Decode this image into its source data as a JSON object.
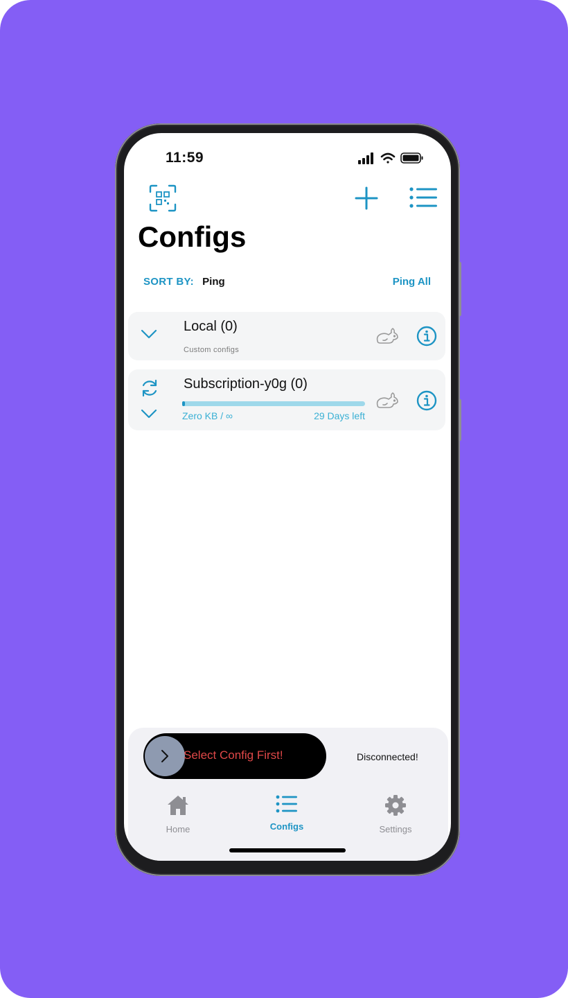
{
  "status_bar": {
    "time": "11:59"
  },
  "header": {
    "title": "Configs"
  },
  "sort": {
    "label": "SORT BY:",
    "value": "Ping",
    "ping_all": "Ping All"
  },
  "groups": [
    {
      "title": "Local (0)",
      "subtitle": "Custom configs"
    },
    {
      "title": "Subscription-y0g (0)",
      "usage": "Zero KB / ∞",
      "days_left": "29 Days left",
      "usage_fraction": 0.01
    }
  ],
  "connect": {
    "slider_text": "Select Config First!",
    "status": "Disconnected!"
  },
  "tabs": [
    {
      "label": "Home",
      "icon": "home-icon"
    },
    {
      "label": "Configs",
      "icon": "list-icon",
      "active": true
    },
    {
      "label": "Settings",
      "icon": "gear-icon"
    }
  ],
  "colors": {
    "background": "#845ef5",
    "accent": "#1d94c4",
    "progress_track": "#9ed8ea",
    "slider_text": "#e04848",
    "inactive_tab": "#8e8e93"
  }
}
